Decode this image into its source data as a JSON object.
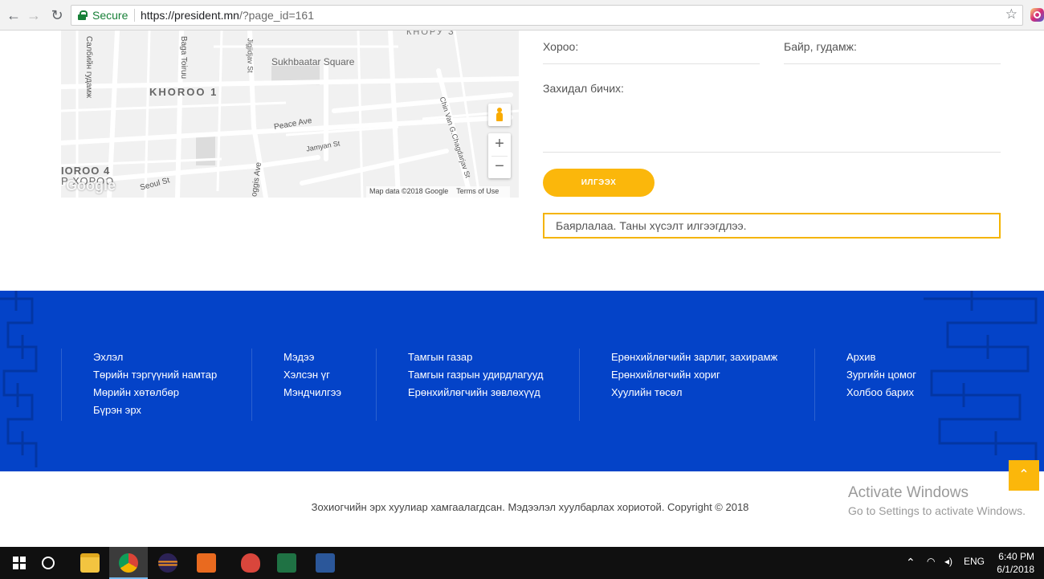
{
  "browser": {
    "secure_label": "Secure",
    "url_host": "https://president.mn",
    "url_path": "/?page_id=161"
  },
  "map": {
    "labels": {
      "khoroo1": "KHOROO 1",
      "khoroo4": "IOROO 4",
      "khoroo4_mn": "Р ХОРОО",
      "square": "Sukhbaatar Square",
      "peace": "Peace Ave",
      "jamyan": "Jamyan St",
      "seoul": "Seoul St",
      "olympic": "oggis Ave",
      "baga": "Baga Toiruu",
      "jigjid": "Jigjidjav St",
      "salbiin": "Салбийн гудамж",
      "chinvan": "Chin Van G.Chagdarjav St",
      "top": "КНОРУ З"
    },
    "google": "Google",
    "credits": {
      "data": "Map data ©2018 Google",
      "terms": "Terms of Use"
    },
    "zoom_in": "+",
    "zoom_out": "−"
  },
  "form": {
    "khoroo_label": "Хороо:",
    "bair_label": "Байр, гудамж:",
    "letter_label": "Захидал бичих:",
    "send_label": "ИЛГЭЭХ",
    "success_message": "Баярлалаа. Таны хүсэлт илгээгдлээ."
  },
  "footer": {
    "columns": [
      [
        "Эхлэл",
        "Төрийн тэргүүний намтар",
        "Мөрийн хөтөлбөр",
        "Бүрэн эрх"
      ],
      [
        "Мэдээ",
        "Хэлсэн үг",
        "Мэндчилгээ"
      ],
      [
        "Тамгын газар",
        "Тамгын газрын удирдлагууд",
        "Ерөнхийлөгчийн зөвлөхүүд"
      ],
      [
        "Ерөнхийлөгчийн зарлиг, захирамж",
        "Ерөнхийлөгчийн хориг",
        "Хуулийн төсөл"
      ],
      [
        "Архив",
        "Зургийн цомог",
        "Холбоо барих"
      ]
    ],
    "copyright": "Зохиогчийн эрх хуулиар хамгаалагдсан. Мэдээлэл хуулбарлах хориотой. Copyright © 2018"
  },
  "activate": {
    "title": "Activate Windows",
    "subtitle": "Go to Settings to activate Windows."
  },
  "to_top_icon": "chevron-up-icon",
  "taskbar": {
    "lang": "ENG",
    "time": "6:40 PM",
    "date": "6/1/2018"
  },
  "colors": {
    "footer_blue": "#0443c8",
    "accent_yellow": "#fbb70b",
    "secure_green": "#188038"
  }
}
